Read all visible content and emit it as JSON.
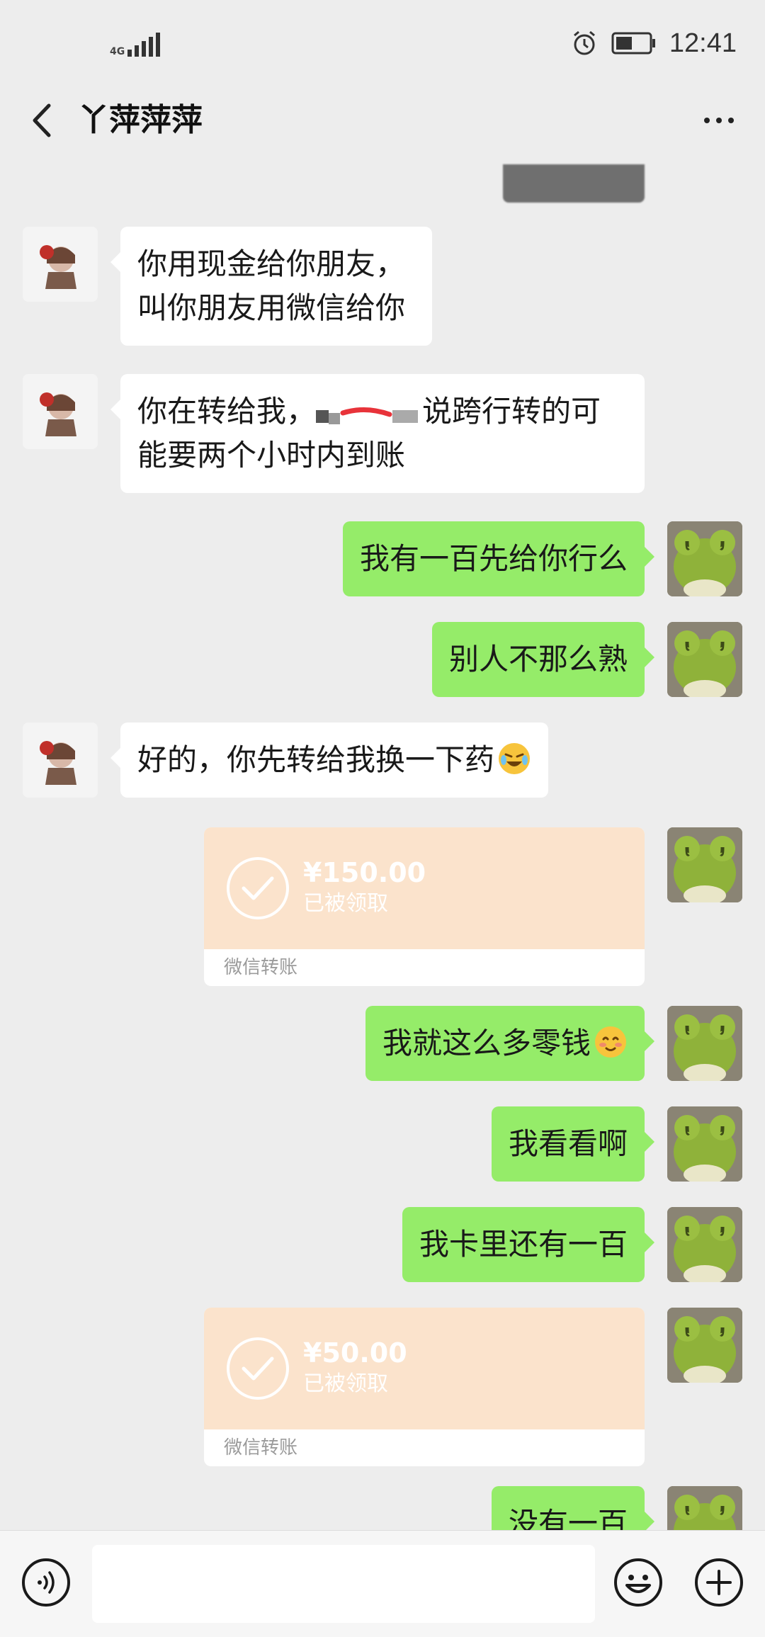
{
  "status_bar": {
    "network": "4G",
    "time": "12:41"
  },
  "nav": {
    "title": "丫萍萍萍"
  },
  "messages": [
    {
      "from": "them",
      "text": "你用现金给你朋友，叫你朋友用微信给你"
    },
    {
      "from": "them",
      "text_before": "你在转给我，",
      "text_after": "说跨行转的可能要两个小时内到账"
    },
    {
      "from": "me",
      "text": "我有一百先给你行么"
    },
    {
      "from": "me",
      "text": "别人不那么熟"
    },
    {
      "from": "them",
      "text": "好的，你先转给我换一下药",
      "emoji": "crying-laughing-emoji"
    },
    {
      "from": "me",
      "type": "transfer",
      "amount": "¥150.00",
      "status": "已被领取",
      "footer": "微信转账"
    },
    {
      "from": "me",
      "text": "我就这么多零钱",
      "emoji": "smiling-blush-emoji"
    },
    {
      "from": "me",
      "text": "我看看啊"
    },
    {
      "from": "me",
      "text": "我卡里还有一百"
    },
    {
      "from": "me",
      "type": "transfer",
      "amount": "¥50.00",
      "status": "已被领取",
      "footer": "微信转账"
    },
    {
      "from": "me",
      "text": "没有一百"
    }
  ],
  "colors": {
    "chat_bg": "#ededed",
    "incoming_bubble": "#ffffff",
    "outgoing_bubble": "#95ec69",
    "transfer_card": "#fbe3cc"
  },
  "icons": {
    "back": "chevron-left-icon",
    "more": "more-dots-icon",
    "voice": "voice-icon",
    "emoji": "emoji-icon",
    "plus": "plus-icon"
  }
}
